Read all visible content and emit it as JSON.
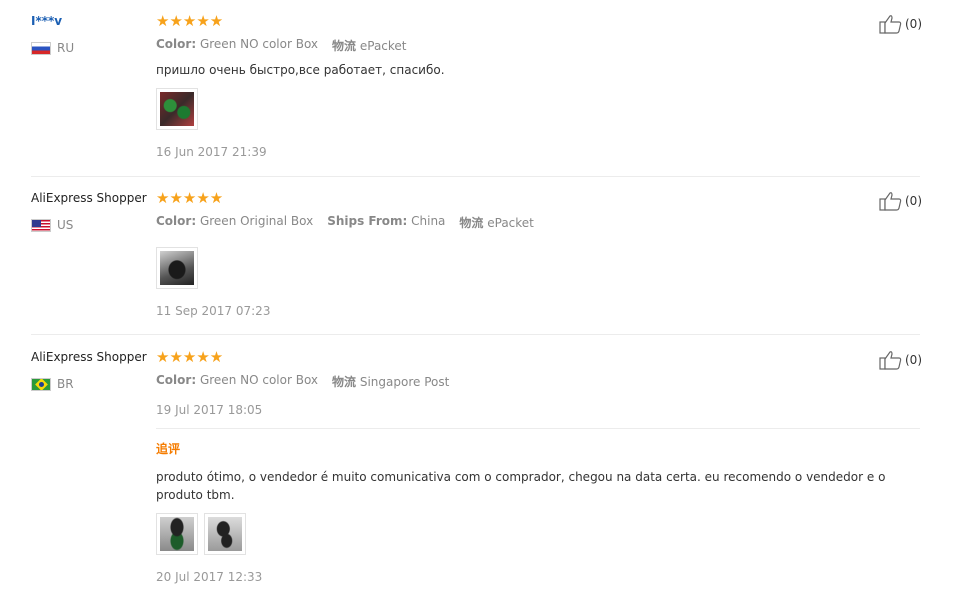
{
  "reviews": [
    {
      "user": "I***v",
      "country": "RU",
      "stars": "★★★★★",
      "attrs": [
        {
          "key": "Color:",
          "value": "Green NO color Box"
        },
        {
          "key": "物流",
          "value": "ePacket"
        }
      ],
      "text": "пришло очень быстро,все работает, спасибо.",
      "date": "16 Jun 2017 21:39",
      "helpful": "(0)"
    },
    {
      "user": "AliExpress Shopper",
      "country": "US",
      "stars": "★★★★★",
      "attrs": [
        {
          "key": "Color:",
          "value": "Green Original Box"
        },
        {
          "key": "Ships From:",
          "value": "China"
        },
        {
          "key": "物流",
          "value": "ePacket"
        }
      ],
      "date": "11 Sep 2017 07:23",
      "helpful": "(0)"
    },
    {
      "user": "AliExpress Shopper",
      "country": "BR",
      "stars": "★★★★★",
      "attrs": [
        {
          "key": "Color:",
          "value": "Green NO color Box"
        },
        {
          "key": "物流",
          "value": "Singapore Post"
        }
      ],
      "date": "19 Jul 2017 18:05",
      "additional_label": "追评",
      "additional_text": "produto ótimo, o vendedor é muito comunicativa com o comprador, chegou na data certa. eu recomendo o vendedor e o produto tbm.",
      "additional_date": "20 Jul 2017 12:33",
      "helpful": "(0)"
    }
  ],
  "colors": {
    "star": "#f7a21b",
    "link": "#1b5fb3",
    "additional": "#f57c00"
  }
}
